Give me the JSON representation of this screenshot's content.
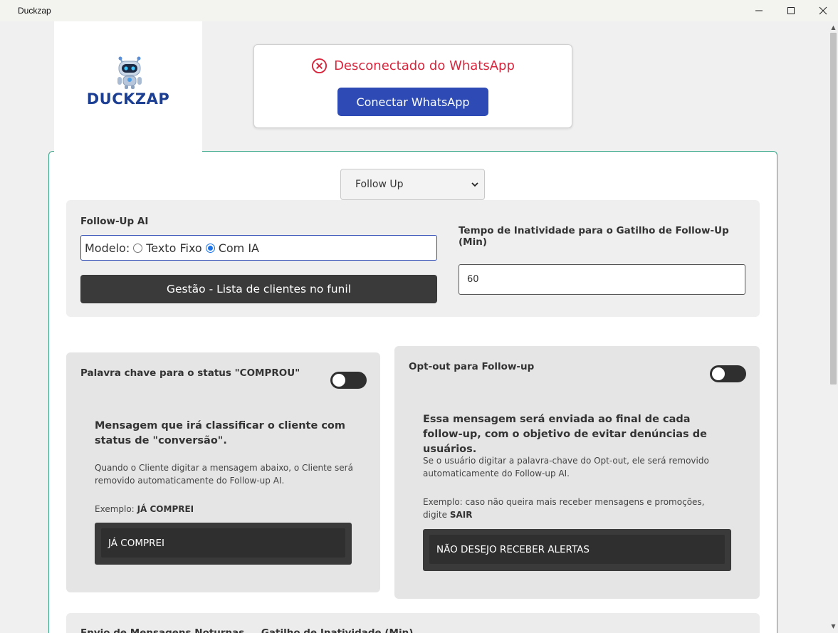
{
  "window": {
    "title": "Duckzap"
  },
  "logo": {
    "text": "DUCKZAP"
  },
  "status": {
    "text": "Desconectado do WhatsApp",
    "connect_label": "Conectar WhatsApp"
  },
  "mode_select": {
    "selected": "Follow Up"
  },
  "followup": {
    "title": "Follow-Up AI",
    "model_label": "Modelo:",
    "option_fixed": "Texto Fixo",
    "option_ai": "Com IA",
    "selected_option": "Com IA",
    "manage_button": "Gestão - Lista de clientes no funil",
    "inactivity_label": "Tempo de Inatividade para o Gatilho de Follow-Up (Min)",
    "inactivity_value": "60"
  },
  "keyword_card": {
    "title": "Palavra chave para o status \"COMPROU\"",
    "enabled": false,
    "heading": "Mensagem que irá classificar o cliente com status de \"conversão\".",
    "description": "Quando o Cliente digitar a mensagem abaixo, o Cliente será removido automaticamente do Follow-up AI.",
    "example_prefix": "Exemplo:",
    "example_value": "JÁ COMPREI",
    "field_value": "JÁ COMPREI"
  },
  "optout_card": {
    "title": "Opt-out para Follow-up",
    "enabled": false,
    "heading": "Essa mensagem será enviada ao final de cada follow-up, com o objetivo de evitar denúncias de usuários.",
    "description": "Se o usuário digitar a palavra-chave do Opt-out, ele será removido automaticamente do Follow-up AI.",
    "example_prefix": "Exemplo: caso não queira mais receber mensagens e promoções, digite",
    "example_value": "SAIR",
    "field_value": "NÃO DESEJO RECEBER ALERTAS"
  },
  "bottom_card": {
    "partial_text": "Envio de Mensagens Noturnas     Gatilho de Inatividade (Min)"
  },
  "colors": {
    "accent": "#2e4bb5",
    "error": "#d7263d",
    "panel_border": "#3aa68a",
    "dark": "#3a3a3a"
  },
  "icons": {
    "status": "x-circle-icon",
    "select": "chevron-down-icon",
    "logo": "robot-icon"
  }
}
